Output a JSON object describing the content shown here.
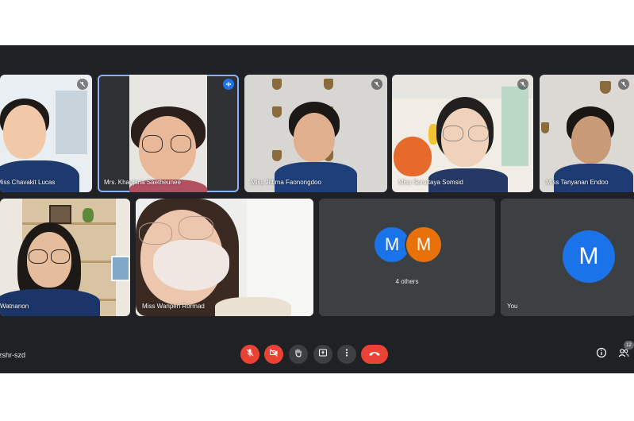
{
  "participants": [
    {
      "name": "Miss Chavakit Lucas",
      "status": "muted"
    },
    {
      "name": "Mrs. Khanjana Saetheunee",
      "status": "speaking"
    },
    {
      "name": "Miss Jittima Faonongdoo",
      "status": "muted"
    },
    {
      "name": "Miss Saruttaya Somsid",
      "status": "muted"
    },
    {
      "name": "Miss Tanyanan Endoo",
      "status": "muted"
    },
    {
      "name": "Watnanon",
      "status": ""
    },
    {
      "name": "Miss Wanpen Rormad",
      "status": ""
    }
  ],
  "others_tile": {
    "initial1": "M",
    "initial2": "M",
    "label": "4 others"
  },
  "self_tile": {
    "initial": "M",
    "label": "You"
  },
  "bottom_bar": {
    "meeting_code": "zshr-szd",
    "participant_count": "12",
    "icons": [
      "mic-off-icon",
      "camera-off-icon",
      "raise-hand-icon",
      "present-icon",
      "more-icon",
      "end-call-icon",
      "info-icon",
      "people-icon"
    ]
  },
  "colors": {
    "background": "#202124",
    "danger": "#ea4335",
    "accent": "#1a73e8",
    "avatar_orange": "#e8710a",
    "active_border": "#8ab4f8"
  }
}
